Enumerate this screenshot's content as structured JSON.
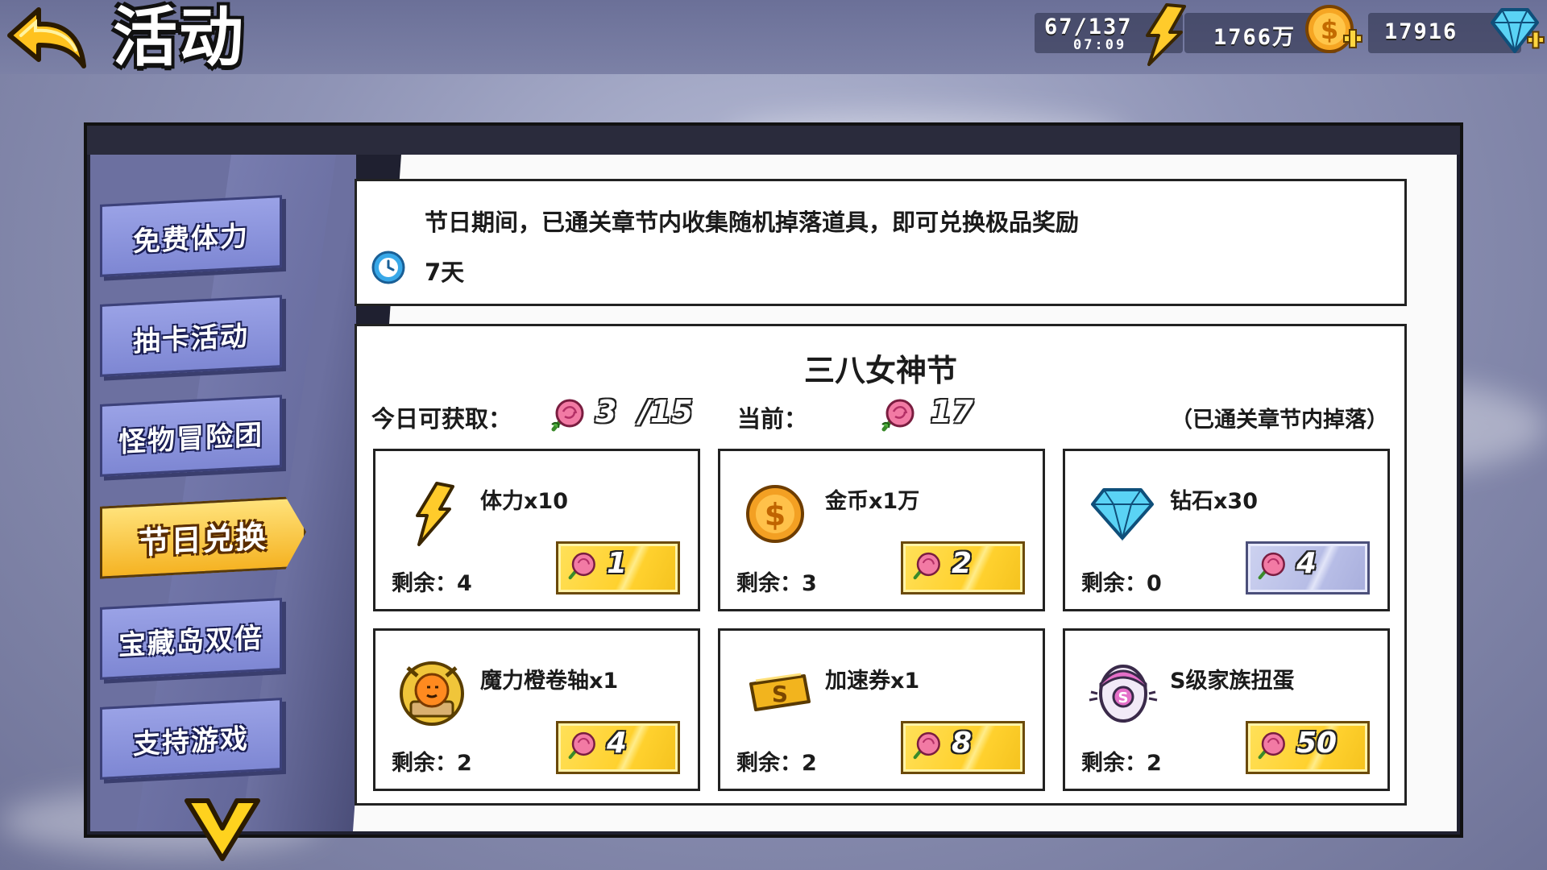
{
  "header": {
    "title": "活动",
    "stamina": {
      "value": "67/137",
      "timer": "07:09"
    },
    "gold": {
      "value": "1766万"
    },
    "diamond": {
      "value": "17916"
    }
  },
  "sidebar": {
    "tabs": [
      {
        "label": "免费体力"
      },
      {
        "label": "抽卡活动"
      },
      {
        "label": "怪物冒险团"
      },
      {
        "label": "节日兑换",
        "active": true
      },
      {
        "label": "宝藏岛双倍"
      },
      {
        "label": "支持游戏"
      }
    ]
  },
  "description": {
    "text": "节日期间，已通关章节内收集随机掉落道具，即可兑换极品奖励",
    "duration": "7天"
  },
  "event": {
    "title": "三八女神节",
    "today_label": "今日可获取：",
    "today_value": "3",
    "today_max": "/15",
    "current_label": "当前：",
    "current_value": "17",
    "note": "（已通关章节内掉落）"
  },
  "rewards": [
    {
      "name": "体力x10",
      "remain_label": "剩余：",
      "remain": "4",
      "cost": "1",
      "icon": "lightning-icon",
      "enabled": true
    },
    {
      "name": "金币x1万",
      "remain_label": "剩余：",
      "remain": "3",
      "cost": "2",
      "icon": "gold-coin-icon",
      "enabled": true
    },
    {
      "name": "钻石x30",
      "remain_label": "剩余：",
      "remain": "0",
      "cost": "4",
      "icon": "diamond-icon",
      "enabled": false
    },
    {
      "name": "魔力橙卷轴x1",
      "remain_label": "剩余：",
      "remain": "2",
      "cost": "4",
      "icon": "orange-scroll-icon",
      "enabled": true
    },
    {
      "name": "加速券x1",
      "remain_label": "剩余：",
      "remain": "2",
      "cost": "8",
      "icon": "speed-ticket-icon",
      "enabled": true
    },
    {
      "name": "S级家族扭蛋",
      "remain_label": "剩余：",
      "remain": "2",
      "cost": "50",
      "icon": "gacha-egg-icon",
      "enabled": true
    }
  ],
  "colors": {
    "active_tab": "#f5b323",
    "tab": "#8a92dc",
    "cost_button": "#ffd12e",
    "cost_button_disabled": "#b7bde6"
  }
}
